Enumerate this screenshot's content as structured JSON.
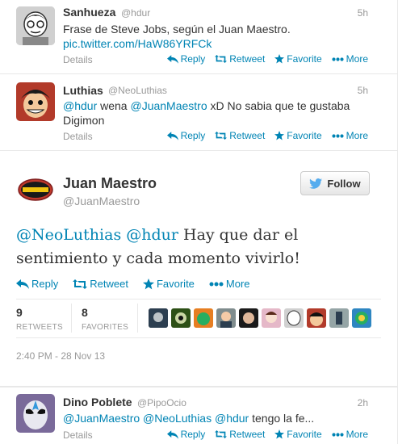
{
  "tweets": [
    {
      "name": "Sanhueza",
      "handle": "@hdur",
      "time": "5h",
      "text": "Frase de Steve Jobs, según el Juan Maestro.",
      "link": "pic.twitter.com/HaW86YRFCk",
      "details": "Details"
    },
    {
      "name": "Luthias",
      "handle": "@NeoLuthias",
      "time": "5h",
      "mention1": "@hdur",
      "mid1": " wena ",
      "mention2": "@JuanMaestro",
      "rest": " xD No sabia que te gustaba Digimon",
      "details": "Details"
    },
    {
      "name": "Dino Poblete",
      "handle": "@PipoOcio",
      "time": "2h",
      "mention1": "@JuanMaestro",
      "mention2": "@NeoLuthias",
      "mention3": "@hdur",
      "rest": " tengo la fe...",
      "details": "Details"
    }
  ],
  "actions": {
    "reply": "Reply",
    "retweet": "Retweet",
    "favorite": "Favorite",
    "more": "More"
  },
  "main": {
    "name": "Juan Maestro",
    "handle": "@JuanMaestro",
    "follow": "Follow",
    "mention1": "@NeoLuthias",
    "mention2": "@hdur",
    "text_rest": " Hay que dar el sentimiento y cada momento vivirlo!",
    "retweets": "9",
    "retweets_label": "RETWEETS",
    "favorites": "8",
    "favorites_label": "FAVORITES",
    "timestamp": "2:40 PM - 28 Nov 13"
  },
  "colors": {
    "link": "#0084b4",
    "muted": "#999999",
    "twitter_blue": "#55acee"
  },
  "icons": [
    "reply-icon",
    "retweet-icon",
    "favorite-star-icon",
    "more-dots-icon",
    "twitter-bird-icon"
  ]
}
